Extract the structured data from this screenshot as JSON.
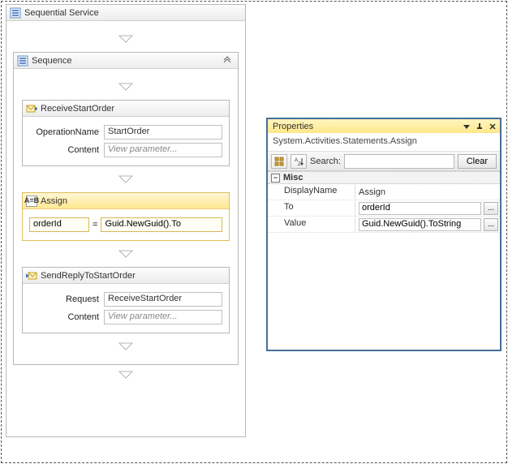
{
  "workflow": {
    "title": "Sequential Service",
    "sequence": {
      "title": "Sequence",
      "activities": {
        "receive": {
          "title": "ReceiveStartOrder",
          "operationName": {
            "label": "OperationName",
            "value": "StartOrder"
          },
          "content": {
            "label": "Content",
            "placeholder": "View parameter..."
          }
        },
        "assign": {
          "title": "Assign",
          "to": "orderId",
          "eq": "=",
          "value": "Guid.NewGuid().To"
        },
        "sendReply": {
          "title": "SendReplyToStartOrder",
          "request": {
            "label": "Request",
            "value": "ReceiveStartOrder"
          },
          "content": {
            "label": "Content",
            "placeholder": "View parameter..."
          }
        }
      }
    }
  },
  "properties": {
    "title": "Properties",
    "typeName": "System.Activities.Statements.Assign",
    "searchLabel": "Search:",
    "searchValue": "",
    "clearLabel": "Clear",
    "category": "Misc",
    "rows": {
      "displayName": {
        "label": "DisplayName",
        "value": "Assign"
      },
      "to": {
        "label": "To",
        "value": "orderId"
      },
      "valueRow": {
        "label": "Value",
        "value": "Guid.NewGuid().ToString"
      }
    },
    "ellipsis": "..."
  }
}
